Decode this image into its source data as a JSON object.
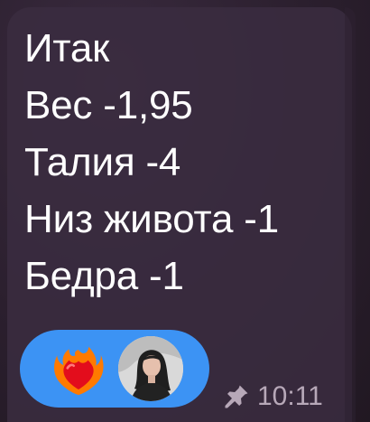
{
  "message": {
    "lines": [
      "Итак",
      "Вес -1,95",
      "Талия -4",
      "Низ живота -1",
      "Бедра -1"
    ]
  },
  "reaction": {
    "emoji": "heart-on-fire-icon",
    "user_avatar": "user-avatar"
  },
  "meta": {
    "pinned": true,
    "time": "10:11"
  },
  "colors": {
    "reaction_bg": "#3c93f4",
    "bubble_bg": "#3a2c40",
    "meta_text": "#b7a8b8"
  }
}
